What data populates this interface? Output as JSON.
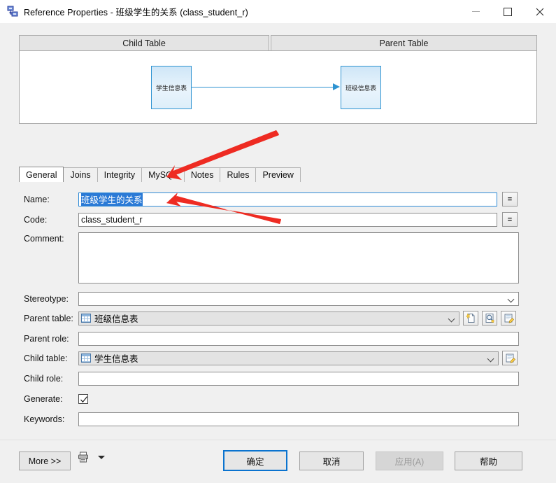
{
  "window": {
    "icon": "reference-icon",
    "title": "Reference Properties - 班级学生的关系 (class_student_r)",
    "minimize_label": "—",
    "maximize_label": "□",
    "close_label": "✕"
  },
  "preview": {
    "child_header": "Child Table",
    "parent_header": "Parent Table",
    "child_box_label": "学生信息表",
    "parent_box_label": "班级信息表"
  },
  "tabs": [
    {
      "label": "General",
      "active": true
    },
    {
      "label": "Joins",
      "active": false
    },
    {
      "label": "Integrity",
      "active": false
    },
    {
      "label": "MySQL",
      "active": false
    },
    {
      "label": "Notes",
      "active": false
    },
    {
      "label": "Rules",
      "active": false
    },
    {
      "label": "Preview",
      "active": false
    }
  ],
  "form": {
    "name": {
      "label": "Name:",
      "value": "班级学生的关系",
      "selected": true,
      "side_button": "="
    },
    "code": {
      "label": "Code:",
      "value": "class_student_r",
      "side_button": "="
    },
    "comment": {
      "label": "Comment:",
      "value": ""
    },
    "stereotype": {
      "label": "Stereotype:",
      "value": ""
    },
    "parent_table": {
      "label": "Parent table:",
      "value": "班级信息表",
      "icon": "table-icon",
      "buttons": [
        "create-icon",
        "browse-icon",
        "properties-icon"
      ]
    },
    "parent_role": {
      "label": "Parent role:",
      "value": ""
    },
    "child_table": {
      "label": "Child table:",
      "value": "学生信息表",
      "icon": "table-icon",
      "buttons": [
        "properties-icon"
      ]
    },
    "child_role": {
      "label": "Child role:",
      "value": ""
    },
    "generate": {
      "label": "Generate:",
      "checked": true
    },
    "keywords": {
      "label": "Keywords:",
      "value": ""
    }
  },
  "bottom": {
    "more": "More >>",
    "print_icon": "print-icon",
    "print_caret": "caret-down-icon",
    "ok": "确定",
    "cancel": "取消",
    "apply": "应用(A)",
    "apply_disabled": true,
    "help": "帮助"
  },
  "annotations": {
    "arrow_to_name": "red-arrow",
    "arrow_to_code": "red-arrow"
  },
  "colors": {
    "accent": "#0a73cf",
    "selection": "#2a7ad6",
    "diagram_stroke": "#2e93d1",
    "annotation": "#ee2b22",
    "dialog_bg": "#f0f0f0"
  }
}
